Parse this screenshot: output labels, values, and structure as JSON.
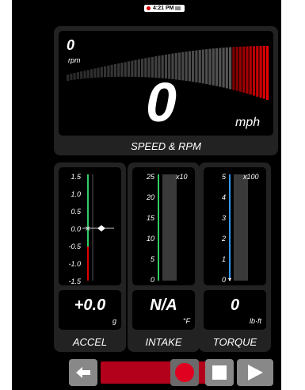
{
  "status_bar": {
    "time": "4:21 PM"
  },
  "speed_panel": {
    "rpm_value": "0",
    "rpm_unit": "rpm",
    "speed_value": "0",
    "speed_unit": "mph",
    "label": "SPEED & RPM"
  },
  "accel": {
    "ticks": [
      "1.5",
      "1.0",
      "0.5",
      "0.0",
      "-0.5",
      "-1.0",
      "-1.5"
    ],
    "value": "+0.0",
    "unit": "g",
    "label": "ACCEL"
  },
  "intake": {
    "ticks": [
      "25",
      "20",
      "15",
      "10",
      "5",
      "0"
    ],
    "multiplier": "x10",
    "value": "N/A",
    "unit": "°F",
    "label": "INTAKE"
  },
  "torque": {
    "ticks": [
      "5",
      "4",
      "3",
      "2",
      "1",
      "0"
    ],
    "multiplier": "x100",
    "value": "0",
    "unit": "lb·ft",
    "label": "TORQUE"
  },
  "controls": {
    "back_icon": "arrow-left-icon",
    "record_icon": "record-icon",
    "stop_icon": "stop-icon",
    "play_icon": "play-icon"
  },
  "colors": {
    "accent_red": "#d40000",
    "accel_scale_green": "#33cc66",
    "accel_scale_red": "#e00000",
    "intake_scale_green": "#33cc66",
    "torque_scale_blue": "#3399ff"
  }
}
